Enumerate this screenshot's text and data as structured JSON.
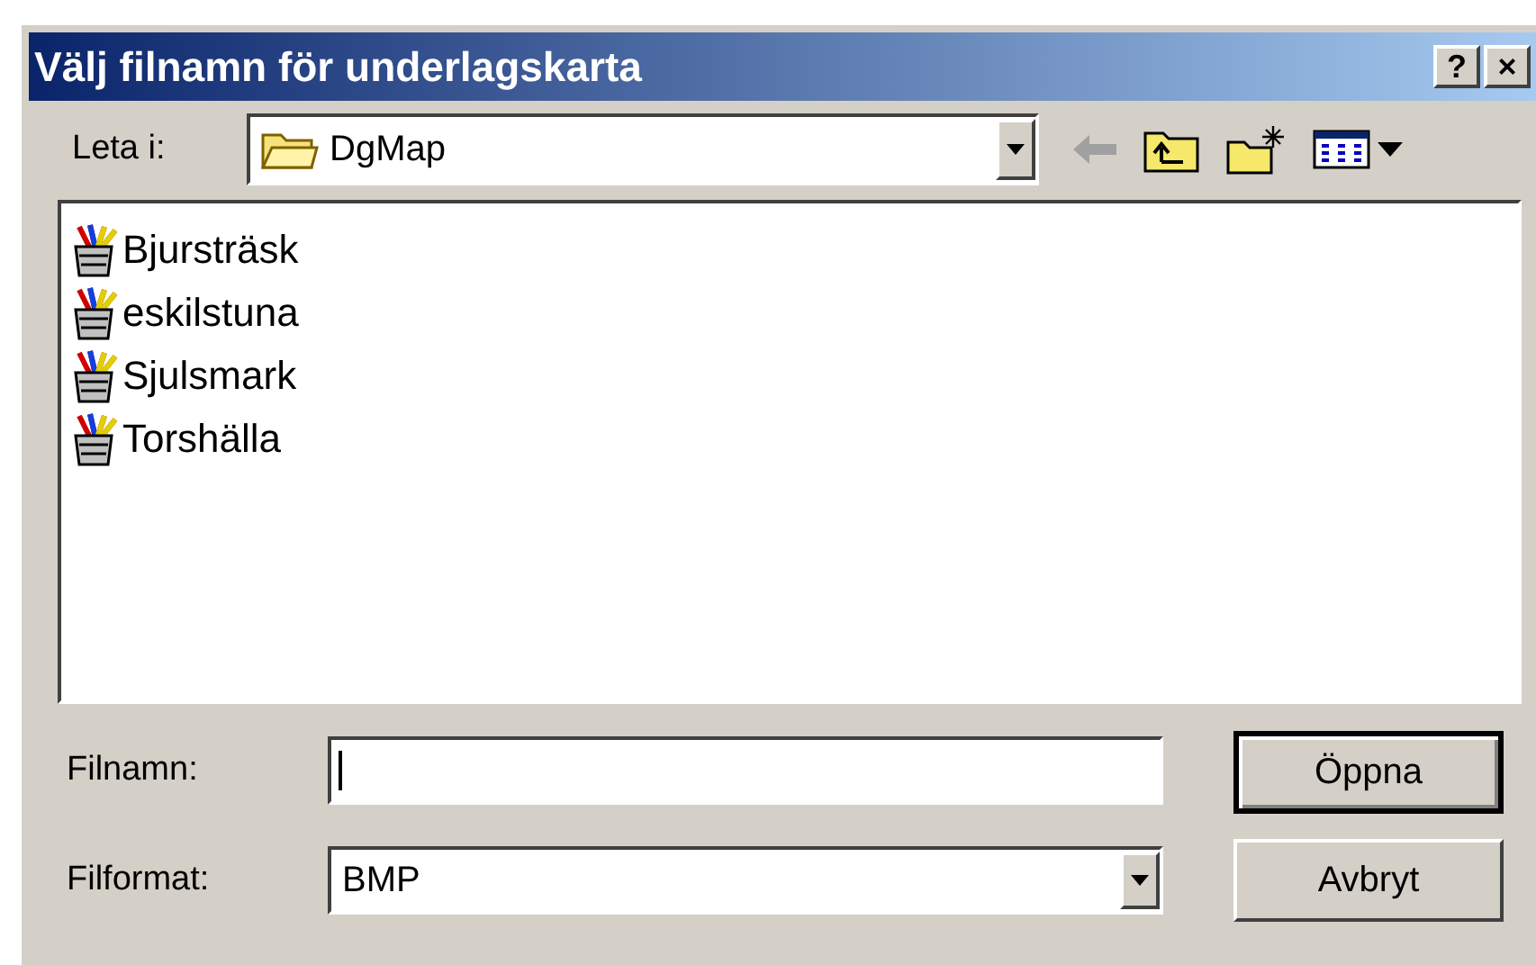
{
  "window": {
    "title": "Välj filnamn för underlagskarta",
    "title_buttons": [
      {
        "label": "?"
      },
      {
        "label": "×"
      }
    ]
  },
  "look_in": {
    "label": "Leta i:",
    "value": "DgMap"
  },
  "files": [
    {
      "name": "Bjursträsk"
    },
    {
      "name": "eskilstuna"
    },
    {
      "name": "Sjulsmark"
    },
    {
      "name": "Torshälla"
    }
  ],
  "file_name": {
    "label": "Filnamn:"
  },
  "file_format": {
    "label": "Filformat:",
    "value": "BMP"
  },
  "buttons": [
    {
      "label": "Öppna",
      "default": true
    },
    {
      "label": "Avbryt",
      "default": false
    }
  ]
}
